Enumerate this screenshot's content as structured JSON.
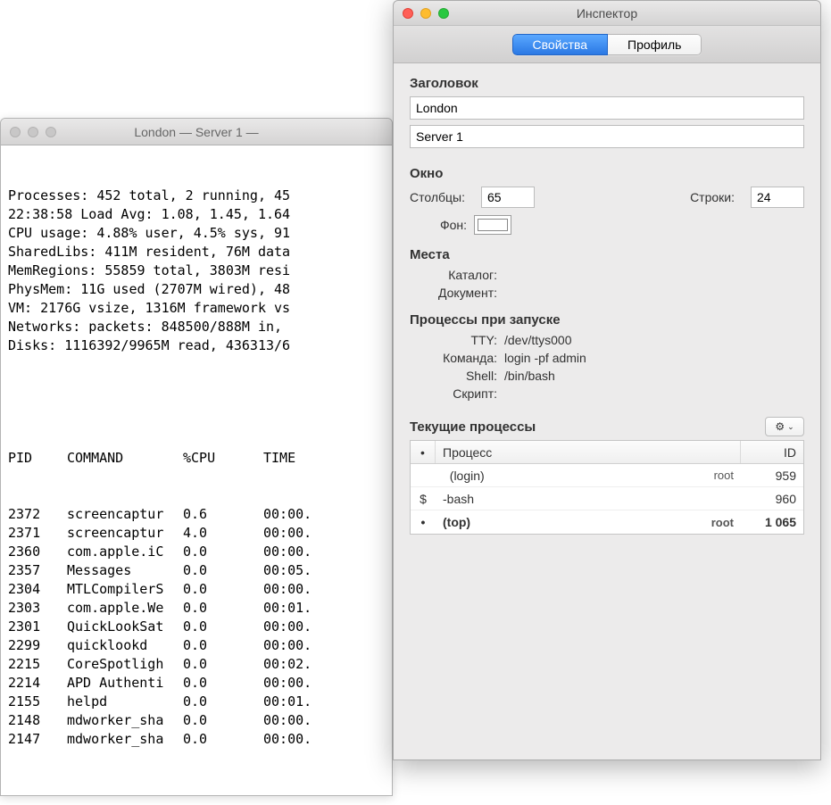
{
  "terminal": {
    "title": "London — Server 1 —",
    "summary_lines": [
      "Processes: 452 total, 2 running, 45",
      "22:38:58 Load Avg: 1.08, 1.45, 1.64",
      "CPU usage: 4.88% user, 4.5% sys, 91",
      "SharedLibs: 411M resident, 76M data",
      "MemRegions: 55859 total, 3803M resi",
      "PhysMem: 11G used (2707M wired), 48",
      "VM: 2176G vsize, 1316M framework vs",
      "Networks: packets: 848500/888M in,",
      "Disks: 1116392/9965M read, 436313/6"
    ],
    "columns": {
      "pid": "PID",
      "cmd": "COMMAND",
      "cpu": "%CPU",
      "time": "TIME"
    },
    "rows": [
      {
        "pid": "2372",
        "cmd": "screencaptur",
        "cpu": "0.6",
        "time": "00:00."
      },
      {
        "pid": "2371",
        "cmd": "screencaptur",
        "cpu": "4.0",
        "time": "00:00."
      },
      {
        "pid": "2360",
        "cmd": "com.apple.iC",
        "cpu": "0.0",
        "time": "00:00."
      },
      {
        "pid": "2357",
        "cmd": "Messages",
        "cpu": "0.0",
        "time": "00:05."
      },
      {
        "pid": "2304",
        "cmd": "MTLCompilerS",
        "cpu": "0.0",
        "time": "00:00."
      },
      {
        "pid": "2303",
        "cmd": "com.apple.We",
        "cpu": "0.0",
        "time": "00:01."
      },
      {
        "pid": "2301",
        "cmd": "QuickLookSat",
        "cpu": "0.0",
        "time": "00:00."
      },
      {
        "pid": "2299",
        "cmd": "quicklookd",
        "cpu": "0.0",
        "time": "00:00."
      },
      {
        "pid": "2215",
        "cmd": "CoreSpotligh",
        "cpu": "0.0",
        "time": "00:02."
      },
      {
        "pid": "2214",
        "cmd": "APD Authenti",
        "cpu": "0.0",
        "time": "00:00."
      },
      {
        "pid": "2155",
        "cmd": "helpd",
        "cpu": "0.0",
        "time": "00:01."
      },
      {
        "pid": "2148",
        "cmd": "mdworker_sha",
        "cpu": "0.0",
        "time": "00:00."
      },
      {
        "pid": "2147",
        "cmd": "mdworker_sha",
        "cpu": "0.0",
        "time": "00:00."
      }
    ]
  },
  "inspector": {
    "title": "Инспектор",
    "tabs": {
      "properties": "Свойства",
      "profile": "Профиль"
    },
    "sections": {
      "header": {
        "title": "Заголовок",
        "field1": "London",
        "field2": "Server 1"
      },
      "window": {
        "title": "Окно",
        "cols_label": "Столбцы:",
        "cols": "65",
        "rows_label": "Строки:",
        "rows": "24",
        "bg_label": "Фон:"
      },
      "places": {
        "title": "Места",
        "catalog_label": "Каталог:",
        "catalog": "",
        "document_label": "Документ:",
        "document": ""
      },
      "launch": {
        "title": "Процессы при запуске",
        "tty_label": "TTY:",
        "tty": "/dev/ttys000",
        "cmd_label": "Команда:",
        "cmd": "login -pf admin",
        "shell_label": "Shell:",
        "shell": "/bin/bash",
        "script_label": "Скрипт:",
        "script": ""
      },
      "running": {
        "title": "Текущие процессы",
        "columns": {
          "mark": "•",
          "proc": "Процесс",
          "id": "ID"
        },
        "rows": [
          {
            "mark": "",
            "name": "(login)",
            "user": "root",
            "id": "959",
            "bold": false,
            "indent": true
          },
          {
            "mark": "$",
            "name": "-bash",
            "user": "",
            "id": "960",
            "bold": false,
            "indent": false
          },
          {
            "mark": "•",
            "name": "(top)",
            "user": "root",
            "id": "1 065",
            "bold": true,
            "indent": false
          }
        ]
      }
    }
  }
}
